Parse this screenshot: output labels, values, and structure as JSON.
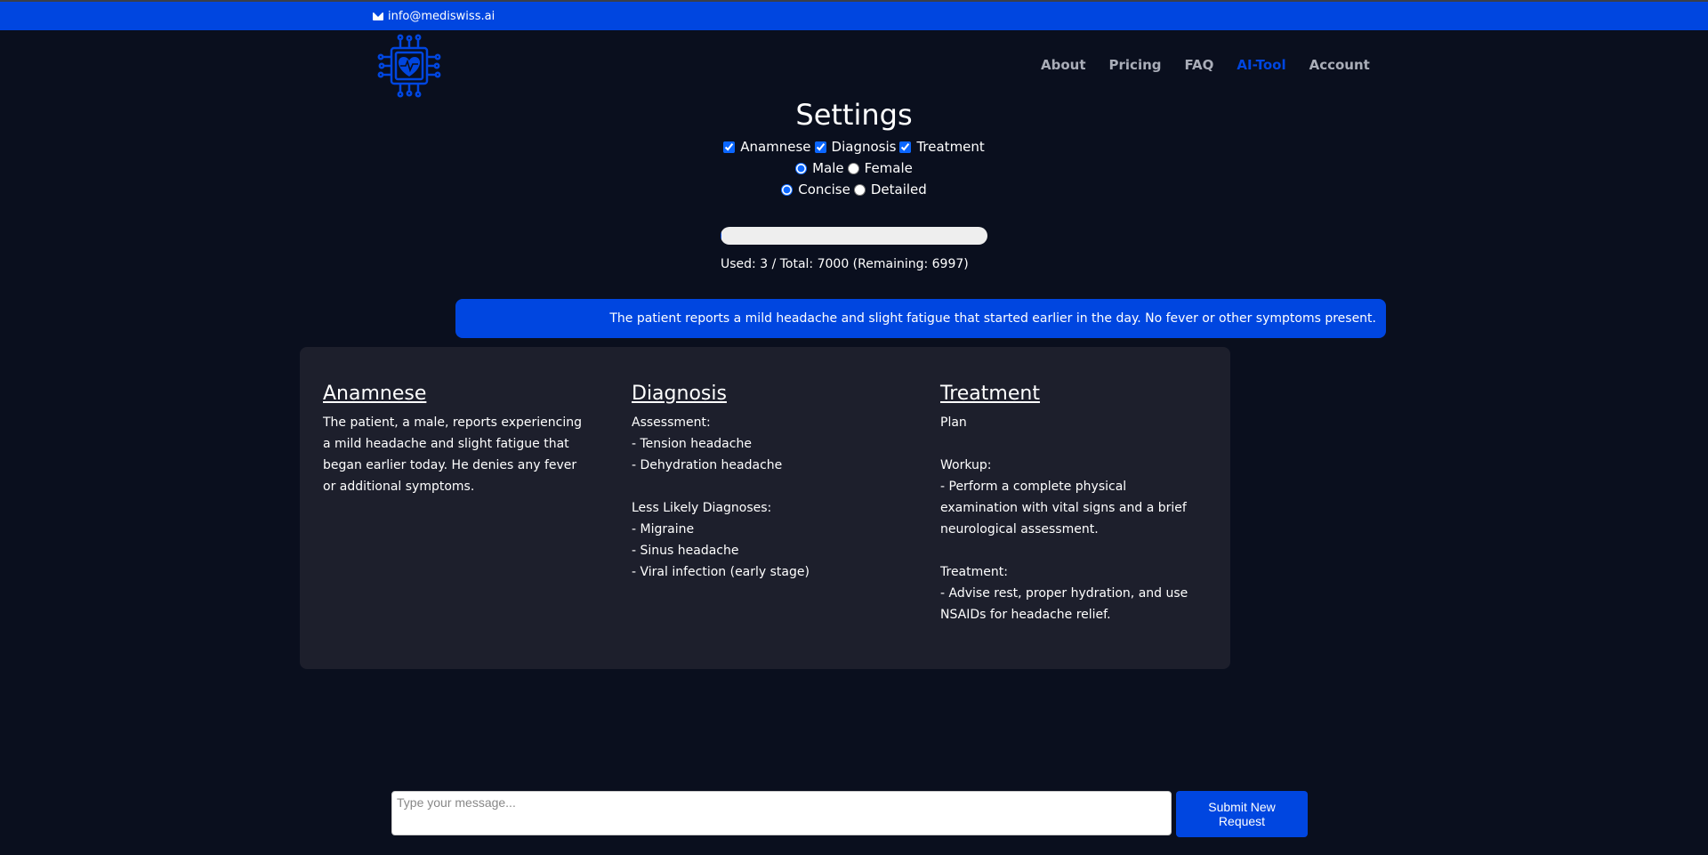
{
  "topbar": {
    "email": "info@mediswiss.ai"
  },
  "colors": {
    "brand": "#0046e0",
    "background": "#0a0f1e",
    "card": "#1d1f2c",
    "nav_text": "#a9adb8"
  },
  "icons": {
    "email": "mail-icon",
    "logo": "heart-chip-icon"
  },
  "nav": {
    "items": [
      "About",
      "Pricing",
      "FAQ",
      "AI-Tool",
      "Account"
    ],
    "active": "AI-Tool"
  },
  "settings": {
    "title": "Settings",
    "sections": [
      {
        "label": "Anamnese",
        "checked": true
      },
      {
        "label": "Diagnosis",
        "checked": true
      },
      {
        "label": "Treatment",
        "checked": true
      }
    ],
    "gender": {
      "options": [
        "Male",
        "Female"
      ],
      "selected": "Male"
    },
    "detail": {
      "options": [
        "Concise",
        "Detailed"
      ],
      "selected": "Concise"
    }
  },
  "usage": {
    "used": 3,
    "total": 7000,
    "remaining": 6997,
    "fraction_used": 0.0004,
    "text": "Used: 3 / Total: 7000 (Remaining: 6997)"
  },
  "message": {
    "text": "The patient reports a mild headache and slight fatigue that started earlier in the day. No fever or other symptoms present."
  },
  "result": {
    "anamnese": {
      "title": "Anamnese",
      "body": "The patient, a male, reports experiencing a mild headache and slight fatigue that began earlier today. He denies any fever or additional symptoms."
    },
    "diagnosis": {
      "title": "Diagnosis",
      "body": "Assessment:\n- Tension headache\n- Dehydration headache\n\nLess Likely Diagnoses:\n- Migraine\n- Sinus headache\n- Viral infection (early stage)"
    },
    "treatment": {
      "title": "Treatment",
      "body": "Plan\n\nWorkup:\n- Perform a complete physical examination with vital signs and a brief neurological assessment.\n\nTreatment:\n- Advise rest, proper hydration, and use NSAIDs for headache relief."
    }
  },
  "composer": {
    "placeholder": "Type your message...",
    "value": "",
    "submit_label": "Submit New Request"
  }
}
